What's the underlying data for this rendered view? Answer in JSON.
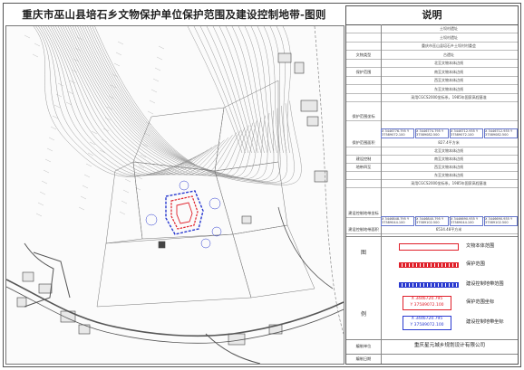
{
  "map": {
    "title": "重庆市巫山县培石乡文物保护单位保护范围及建设控制地带-图则"
  },
  "legend": {
    "heading": "说明",
    "rows": [
      {
        "label": "",
        "value": "土坝村遗址"
      },
      {
        "label": "",
        "value": "土坝村遗址"
      },
      {
        "label": "",
        "value": "重庆市巫山县培石乡土坝村村委会"
      },
      {
        "label": "文物类型",
        "value": "古遗址"
      },
      {
        "label": "",
        "value": "北至文物本体边线"
      },
      {
        "label": "保护范围",
        "value": "南至文物本体边线"
      },
      {
        "label": "",
        "value": "西至文物本体边线"
      },
      {
        "label": "",
        "value": "东至文物本体边线"
      },
      {
        "label": "",
        "value": "采用CGCS2000坐标系，1985年国家高程基准"
      },
      {
        "label": "保护范围坐标",
        "value": ""
      },
      {
        "label": "保护范围面积",
        "value": "827.4平方米"
      },
      {
        "label": "",
        "value": "北至文物本体边线"
      },
      {
        "label": "建设控制",
        "value": "南至文物本体边线"
      },
      {
        "label": "地带四至",
        "value": "西至文物本体边线"
      },
      {
        "label": "",
        "value": "东至文物本体边线"
      },
      {
        "label": "",
        "value": "采用CGCS2000坐标系，1985年国家高程基准"
      },
      {
        "label": "建设控制地带坐标",
        "value": ""
      },
      {
        "label": "建设控制地带面积",
        "value": "6534.48平方米"
      }
    ],
    "coords_protect": [
      "X 3446776.795  Y 37589072.100",
      "X 3446774.795  Y 37589082.500",
      "X 3446712.935  Y 37589072.100",
      "X 3446712.935  Y 37589082.500"
    ],
    "coords_control": [
      "X 3446848.795  Y 37589044.100",
      "X 3446840.795  Y 37589102.500",
      "X 3446690.935  Y 37589044.100",
      "X 3446690.935  Y 37589102.500"
    ],
    "symbols_label_top": "图",
    "symbols_label_bottom": "例",
    "symbols": [
      {
        "name": "文物本体范围"
      },
      {
        "name": "保护范围"
      },
      {
        "name": "建设控制地带范围"
      },
      {
        "name": "保护范围坐标",
        "sample": [
          "X 3446720.795",
          "Y 37589072.100"
        ]
      },
      {
        "name": "建设控制地带坐标",
        "sample": [
          "X 3446720.795",
          "Y 37589072.100"
        ]
      }
    ],
    "company_label": "编制单位",
    "company": "重庆星元城乡规划设计有限公司",
    "date_label": "编制日期",
    "date": ""
  },
  "colors": {
    "entity": "#e0202a",
    "protect": "#e0202a",
    "control": "#2a3ad0",
    "terrain": "#888888",
    "road": "#555555"
  }
}
